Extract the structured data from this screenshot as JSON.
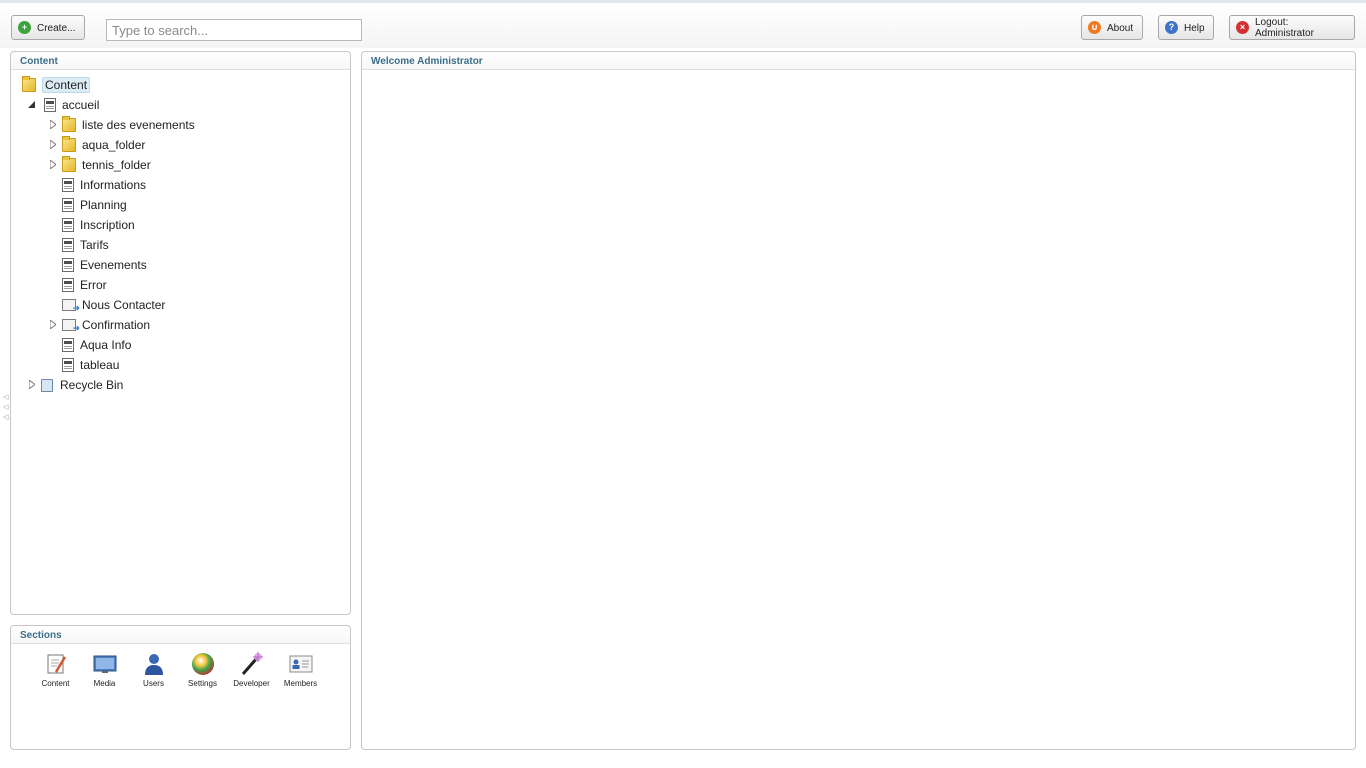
{
  "toolbar": {
    "create_label": "Create...",
    "search_placeholder": "Type to search...",
    "about_label": "About",
    "help_label": "Help",
    "logout_label": "Logout: Administrator"
  },
  "content_panel": {
    "title": "Content",
    "tree": {
      "root": "Content",
      "accueil": "accueil",
      "items": [
        {
          "label": "liste des evenements",
          "icon": "folder-icon",
          "expandable": true
        },
        {
          "label": "aqua_folder",
          "icon": "folder-icon",
          "expandable": true
        },
        {
          "label": "tennis_folder",
          "icon": "folder-icon",
          "expandable": true
        },
        {
          "label": "Informations",
          "icon": "document-icon",
          "expandable": false
        },
        {
          "label": "Planning",
          "icon": "document-icon",
          "expandable": false
        },
        {
          "label": "Inscription",
          "icon": "document-icon",
          "expandable": false
        },
        {
          "label": "Tarifs",
          "icon": "document-icon",
          "expandable": false
        },
        {
          "label": "Evenements",
          "icon": "document-icon",
          "expandable": false
        },
        {
          "label": "Error",
          "icon": "document-icon",
          "expandable": false
        },
        {
          "label": "Nous Contacter",
          "icon": "mail-icon",
          "expandable": false
        },
        {
          "label": "Confirmation",
          "icon": "mail-icon",
          "expandable": true
        },
        {
          "label": "Aqua Info",
          "icon": "document-icon",
          "expandable": false
        },
        {
          "label": "tableau",
          "icon": "document-icon",
          "expandable": false
        }
      ],
      "recycle_bin": "Recycle Bin"
    }
  },
  "sections_panel": {
    "title": "Sections",
    "items": [
      {
        "label": "Content",
        "icon": "content-section-icon"
      },
      {
        "label": "Media",
        "icon": "media-section-icon"
      },
      {
        "label": "Users",
        "icon": "users-section-icon"
      },
      {
        "label": "Settings",
        "icon": "settings-section-icon"
      },
      {
        "label": "Developer",
        "icon": "developer-section-icon"
      },
      {
        "label": "Members",
        "icon": "members-section-icon"
      }
    ]
  },
  "main_panel": {
    "title": "Welcome Administrator"
  },
  "colors": {
    "panel_title": "#3a6e8a",
    "create_icon": "#3aa33a",
    "about_icon": "#ef7a22",
    "help_icon": "#3d74c8",
    "logout_icon": "#d33131"
  }
}
